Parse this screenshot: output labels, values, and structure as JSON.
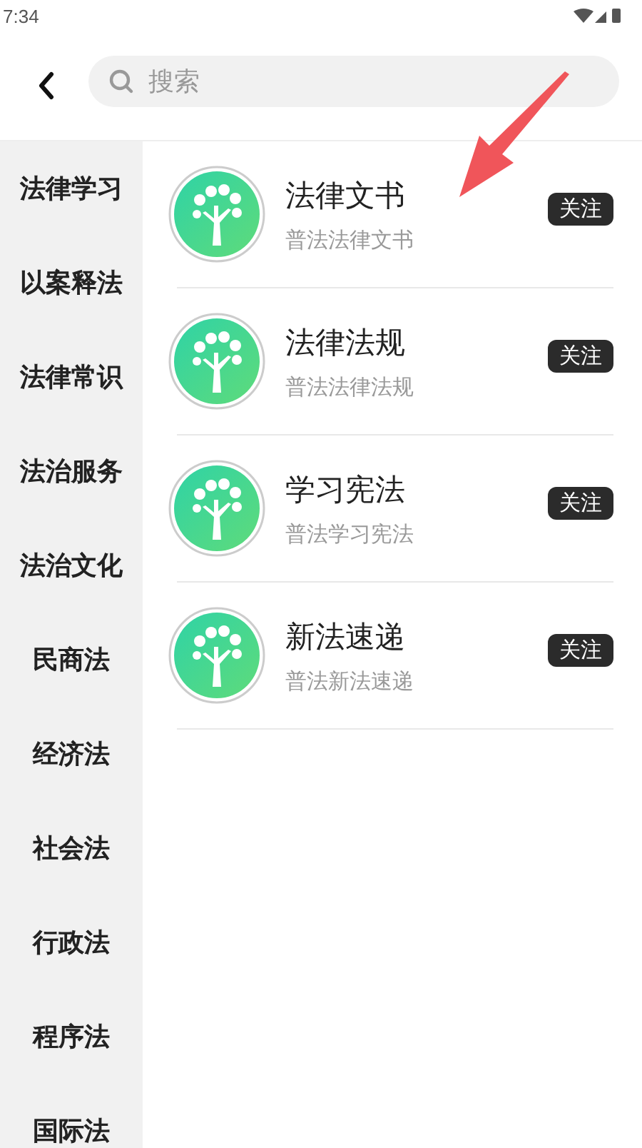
{
  "status_bar": {
    "time": "7:34"
  },
  "search": {
    "placeholder": "搜索"
  },
  "sidebar": {
    "items": [
      {
        "label": "法律学习"
      },
      {
        "label": "以案释法"
      },
      {
        "label": "法律常识"
      },
      {
        "label": "法治服务"
      },
      {
        "label": "法治文化"
      },
      {
        "label": "民商法"
      },
      {
        "label": "经济法"
      },
      {
        "label": "社会法"
      },
      {
        "label": "行政法"
      },
      {
        "label": "程序法"
      },
      {
        "label": "国际法"
      }
    ]
  },
  "channels": [
    {
      "title": "法律文书",
      "subtitle": "普法法律文书",
      "button": "关注"
    },
    {
      "title": "法律法规",
      "subtitle": "普法法律法规",
      "button": "关注"
    },
    {
      "title": "学习宪法",
      "subtitle": "普法学习宪法",
      "button": "关注"
    },
    {
      "title": "新法速递",
      "subtitle": "普法新法速递",
      "button": "关注"
    }
  ]
}
